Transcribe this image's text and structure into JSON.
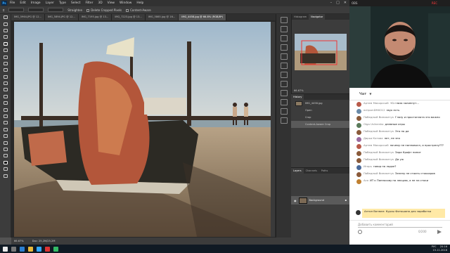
{
  "menubar": {
    "items": [
      "File",
      "Edit",
      "Image",
      "Layer",
      "Type",
      "Select",
      "Filter",
      "3D",
      "View",
      "Window",
      "Help"
    ]
  },
  "options": {
    "straighten": "Straighten",
    "delete_cropped": "Delete Cropped Pixels",
    "content_aware": "Content-Aware"
  },
  "doc_tabs": [
    {
      "label": "IMG_5964.JPG @ 12..."
    },
    {
      "label": "IMG_5894.JPG @ 12..."
    },
    {
      "label": "IMG_7195.jpg @ 13..."
    },
    {
      "label": "IMG_7223.jpg @ 13..."
    },
    {
      "label": "IMG_5865.jpg @ 16..."
    },
    {
      "label": "IMG_4458.jpg @ 66.8% (RGB/8*)"
    }
  ],
  "statusbar": {
    "zoom": "66.67%",
    "doc": "Doc: 25,2M/25,2M"
  },
  "panels": {
    "tab_histogram": "Histogram",
    "tab_navigator": "Navigator",
    "nav_zoom": "66.67%",
    "history_tab": "History",
    "history": [
      {
        "label": "IMG_4458.jpg"
      },
      {
        "label": "Open"
      },
      {
        "label": "Crop"
      },
      {
        "label": "Content-Aware Crop"
      }
    ],
    "layers_tabs": [
      "Layers",
      "Channels",
      "Paths"
    ],
    "layer_name": "Background"
  },
  "stream": {
    "title": "OBS",
    "rec": "REC",
    "chat_title": "Чат",
    "messages": [
      {
        "author": "Артем Макорский",
        "text": "+1 глаза залипнут...",
        "color": "#b85a4a"
      },
      {
        "author": "eclipsmDM0012",
        "text": "звук есть",
        "color": "#6a8aa8"
      },
      {
        "author": "Победный Виникетук",
        "text": "Глазу и простоплата это важно",
        "color": "#8a5a3a"
      },
      {
        "author": "Olga Uslinenko",
        "text": "дневные игры",
        "color": "#5a7a5a"
      },
      {
        "author": "Победный Виникетук",
        "text": "Это по да",
        "color": "#8a5a3a"
      },
      {
        "author": "Дарья Котова",
        "text": "нет, не зня",
        "color": "#9a6aa0"
      },
      {
        "author": "Артем Макорский",
        "text": "почему не панноволл, и прострелу???",
        "color": "#b85a4a"
      },
      {
        "author": "Победный Виникетук",
        "text": "Зара Крофт пипит",
        "color": "#8a5a3a"
      },
      {
        "author": "Победный Виникетук",
        "text": "Да уж",
        "color": "#8a5a3a"
      },
      {
        "author": "Игорь",
        "text": "говор на лодке?",
        "color": "#4a6a9a"
      },
      {
        "author": "Победный Виникетук",
        "text": "Зелену не стоить стокохров",
        "color": "#8a5a3a"
      },
      {
        "author": "Ася",
        "text": "ИТ к Панносову на лекцию, а не на стоки",
        "color": "#c08030"
      }
    ],
    "pinned": "Антон Ватман: Курсы Фотошопа для заработка",
    "input_placeholder": "Добавить комментарий",
    "input_count": "0/200"
  },
  "taskbar": {
    "time": "20:16",
    "date": "15.11.2018",
    "lang": "РУС"
  }
}
